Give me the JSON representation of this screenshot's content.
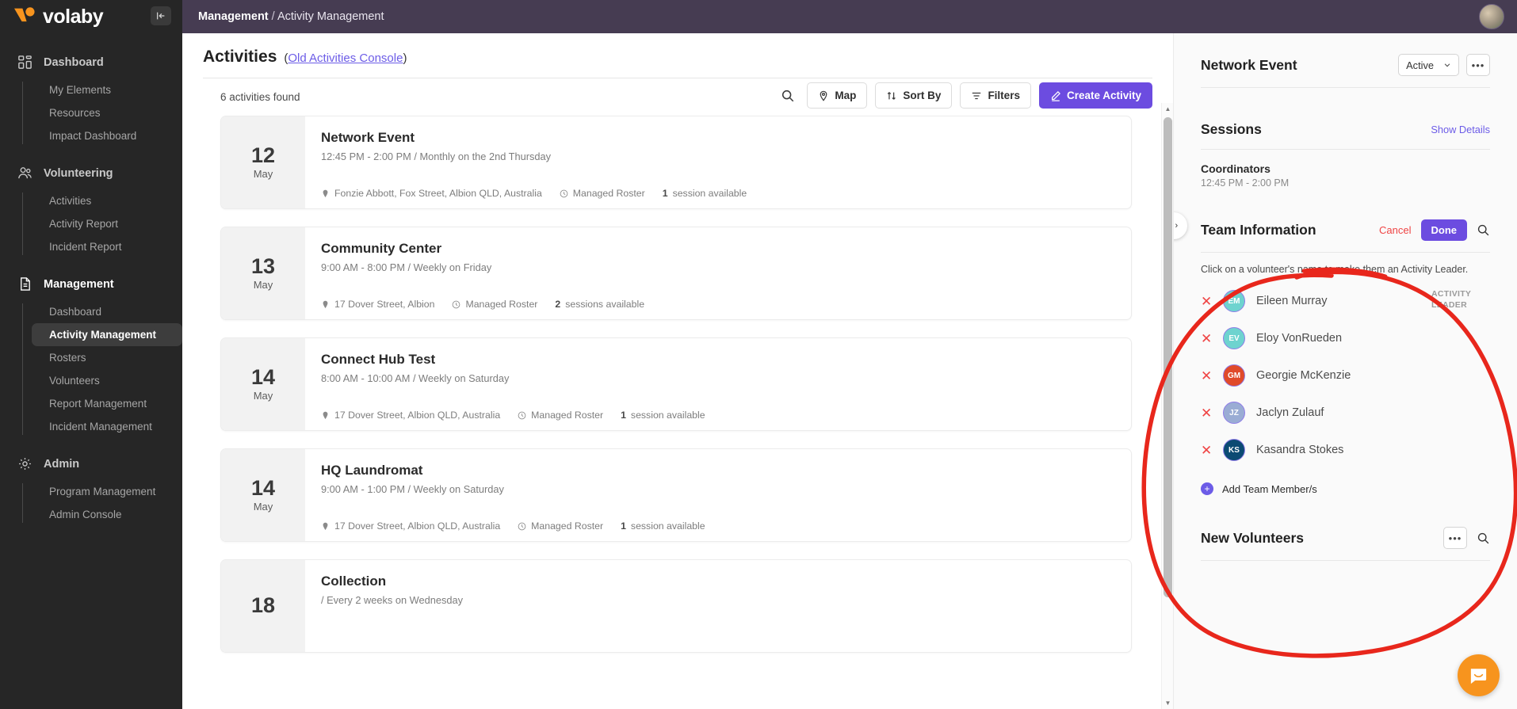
{
  "brand": {
    "name": "volaby",
    "collapse_icon": "collapse-sidebar-icon"
  },
  "topbar": {
    "breadcrumb_root": "Management",
    "breadcrumb_sep": " / ",
    "breadcrumb_leaf": "Activity Management"
  },
  "sidebar": {
    "groups": [
      {
        "label": "Dashboard",
        "icon": "grid-icon",
        "active": false,
        "items": [
          {
            "label": "My Elements",
            "selected": false
          },
          {
            "label": "Resources",
            "selected": false
          },
          {
            "label": "Impact Dashboard",
            "selected": false
          }
        ]
      },
      {
        "label": "Volunteering",
        "icon": "people-icon",
        "active": false,
        "items": [
          {
            "label": "Activities",
            "selected": false
          },
          {
            "label": "Activity Report",
            "selected": false
          },
          {
            "label": "Incident Report",
            "selected": false
          }
        ]
      },
      {
        "label": "Management",
        "icon": "document-icon",
        "active": true,
        "items": [
          {
            "label": "Dashboard",
            "selected": false
          },
          {
            "label": "Activity Management",
            "selected": true
          },
          {
            "label": "Rosters",
            "selected": false
          },
          {
            "label": "Volunteers",
            "selected": false
          },
          {
            "label": "Report Management",
            "selected": false
          },
          {
            "label": "Incident Management",
            "selected": false
          }
        ]
      },
      {
        "label": "Admin",
        "icon": "gear-icon",
        "active": false,
        "items": [
          {
            "label": "Program Management",
            "selected": false
          },
          {
            "label": "Admin Console",
            "selected": false
          }
        ]
      }
    ]
  },
  "activities_page": {
    "title": "Activities",
    "link_open_paren": "(",
    "link_label": "Old Activities Console",
    "link_close_paren": ")",
    "found_text": "6 activities found",
    "toolbar": {
      "search_icon": "search-icon",
      "map_label": "Map",
      "sort_label": "Sort By",
      "filters_label": "Filters",
      "create_label": "Create Activity"
    },
    "cards": [
      {
        "day": "12",
        "month": "May",
        "name": "Network Event",
        "time": "12:45 PM - 2:00 PM / Monthly on the 2nd Thursday",
        "location": "Fonzie Abbott, Fox Street, Albion QLD, Australia",
        "roster": "Managed Roster",
        "sessions_count": "1",
        "sessions_label": "session available"
      },
      {
        "day": "13",
        "month": "May",
        "name": "Community Center",
        "time": "9:00 AM - 8:00 PM / Weekly on Friday",
        "location": "17 Dover Street, Albion",
        "roster": "Managed Roster",
        "sessions_count": "2",
        "sessions_label": "sessions available"
      },
      {
        "day": "14",
        "month": "May",
        "name": "Connect Hub Test",
        "time": "8:00 AM - 10:00 AM / Weekly on Saturday",
        "location": "17 Dover Street, Albion QLD, Australia",
        "roster": "Managed Roster",
        "sessions_count": "1",
        "sessions_label": "session available"
      },
      {
        "day": "14",
        "month": "May",
        "name": "HQ Laundromat",
        "time": "9:00 AM - 1:00 PM / Weekly on Saturday",
        "location": "17 Dover Street, Albion QLD, Australia",
        "roster": "Managed Roster",
        "sessions_count": "1",
        "sessions_label": "session available"
      },
      {
        "day": "18",
        "month": "",
        "name": "Collection",
        "time": "/ Every 2 weeks on Wednesday",
        "location": "",
        "roster": "",
        "sessions_count": "",
        "sessions_label": ""
      }
    ]
  },
  "detail_panel": {
    "activity_name": "Network Event",
    "status_value": "Active",
    "status_caret": "chevron-down-icon",
    "kebab": "•••",
    "sessions": {
      "title": "Sessions",
      "show_details": "Show Details",
      "coordinator_label": "Coordinators",
      "coordinator_time": "12:45 PM - 2:00 PM"
    },
    "team": {
      "title": "Team Information",
      "cancel_label": "Cancel",
      "done_label": "Done",
      "search_icon": "search-icon",
      "hint": "Click on a volunteer's name to make them an Activity Leader.",
      "leader_tag_line1": "ACTIVITY",
      "leader_tag_line2": "LEADER",
      "members": [
        {
          "initials": "EM",
          "name": "Eileen Murray",
          "color": "#6ed3cf",
          "is_leader": true
        },
        {
          "initials": "EV",
          "name": "Eloy VonRueden",
          "color": "#6ed3cf",
          "is_leader": false
        },
        {
          "initials": "GM",
          "name": "Georgie McKenzie",
          "color": "#e04a2a",
          "is_leader": false
        },
        {
          "initials": "JZ",
          "name": "Jaclyn Zulauf",
          "color": "#9aacd4",
          "is_leader": false
        },
        {
          "initials": "KS",
          "name": "Kasandra Stokes",
          "color": "#0b4a73",
          "is_leader": false
        }
      ],
      "add_label": "Add Team Member/s"
    },
    "new_volunteers": {
      "title": "New Volunteers",
      "kebab": "•••",
      "search_icon": "search-icon"
    }
  },
  "annotation": {
    "color": "#e8271c",
    "shape": "hand-drawn-circle"
  },
  "colors": {
    "brand_orange": "#f7941e",
    "accent_purple": "#6c4ce0",
    "topbar": "#463c52",
    "sidebar": "#262626",
    "danger_red": "#ef4444"
  }
}
